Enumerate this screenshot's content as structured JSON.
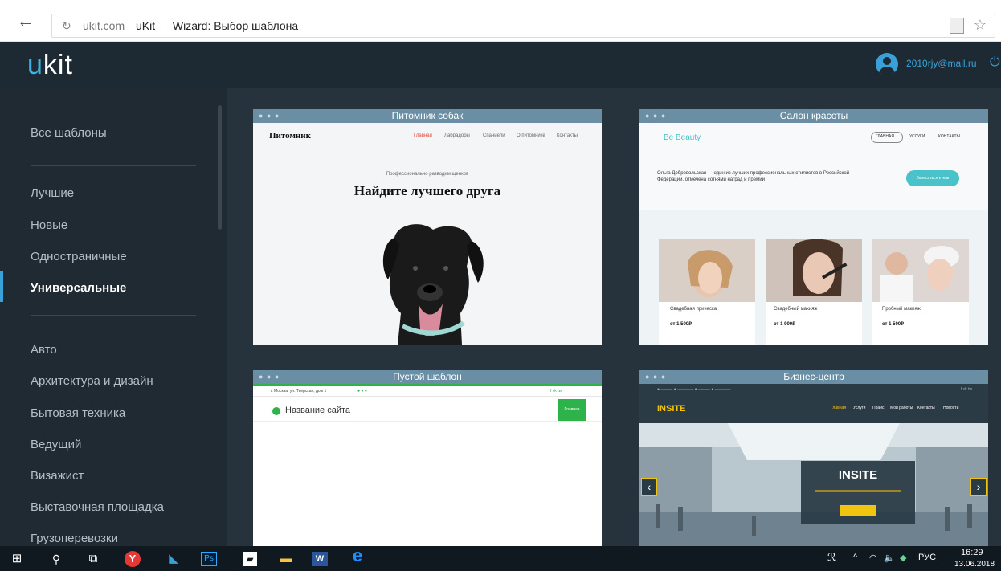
{
  "browser": {
    "domain": "ukit.com",
    "title": "uKit — Wizard: Выбор шаблона"
  },
  "header": {
    "logo_u": "u",
    "logo_rest": "kit",
    "email": "2010rjy@mail.ru"
  },
  "sidebar": {
    "items": [
      "Все шаблоны",
      "Лучшие",
      "Новые",
      "Одностраничные",
      "Универсальные",
      "Авто",
      "Архитектура и дизайн",
      "Бытовая техника",
      "Ведущий",
      "Визажист",
      "Выставочная площадка",
      "Грузоперевозки"
    ],
    "active": "Универсальные"
  },
  "cards": [
    {
      "title": "Питомник собак",
      "brand": "Питомник",
      "nav": [
        "Главная",
        "Лабрадоры",
        "Спаниели",
        "О питомнике",
        "Контакты"
      ],
      "tagline": "Профессионально разводим щенков",
      "heading": "Найдите лучшего друга"
    },
    {
      "title": "Салон красоты",
      "brand": "Be Beauty",
      "nav": [
        "ГЛАВНАЯ",
        "УСЛУГИ",
        "КОНТАКТЫ"
      ],
      "text": "Ольга Добровольская — один из лучших профессиональных стилистов в Российской Федерации, отмечена сотнями наград и премий",
      "button": "Записаться к нам",
      "services": [
        {
          "name": "Свадебная прическа",
          "price": "от 1 500₽"
        },
        {
          "name": "Свадебный макияж",
          "price": "от 1 900₽"
        },
        {
          "name": "Пробный макияж",
          "price": "от 1 500₽"
        }
      ]
    },
    {
      "title": "Пустой шаблон",
      "contact": "г. Москва, ул. Тверская, дом 1",
      "site_name": "Название сайта",
      "nav_button": "Главная"
    },
    {
      "title": "Бизнес-центр",
      "brand": "INSITE",
      "nav": [
        "Главная",
        "Услуги",
        "Прайс",
        "Мои работы",
        "Контакты",
        "Новости"
      ],
      "hero": "INSITE"
    }
  ],
  "tray": {
    "lang": "РУС",
    "time": "16:29",
    "date": "13.06.2018"
  },
  "colors": {
    "header": "#1e2a33",
    "sidebar": "#1f2a33",
    "main": "#26333d",
    "accent": "#3aa0d8",
    "card_bar": "#6a8fa5"
  }
}
